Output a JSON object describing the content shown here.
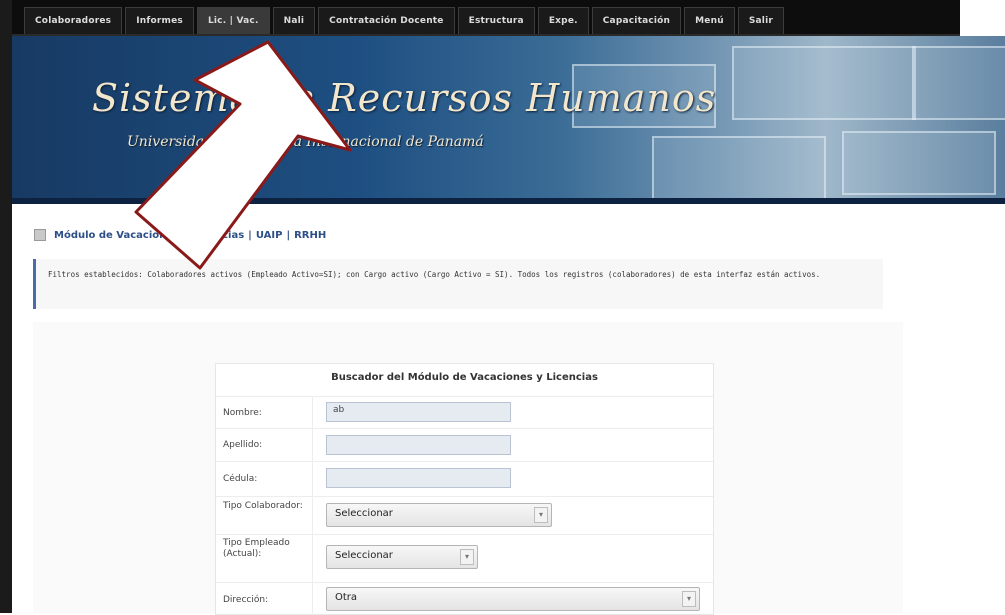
{
  "nav": {
    "tabs": [
      {
        "label": "Colaboradores"
      },
      {
        "label": "Informes"
      },
      {
        "label": "Lic. | Vac."
      },
      {
        "label": "Nali"
      },
      {
        "label": "Contratación Docente"
      },
      {
        "label": "Estructura"
      },
      {
        "label": "Expe."
      },
      {
        "label": "Capacitación"
      },
      {
        "label": "Menú"
      },
      {
        "label": "Salir"
      }
    ]
  },
  "banner": {
    "title": "Sistema de Recursos Humanos",
    "subtitle": "Universidad Tecnológica Internacional de Panamá"
  },
  "breadcrumb": {
    "items": [
      "Módulo de Vacaciones y Licencias",
      "UAIP",
      "RRHH"
    ],
    "separator": "|"
  },
  "note": {
    "text": "Filtros establecidos: Colaboradores activos (Empleado Activo=SI); con Cargo activo (Cargo Activo = SI). Todos los registros (colaboradores) de esta interfaz están activos."
  },
  "form": {
    "title": "Buscador del Módulo de Vacaciones y Licencias",
    "nombre_label": "Nombre:",
    "nombre_value": "ab",
    "apellido_label": "Apellido:",
    "apellido_value": "",
    "cedula_label": "Cédula:",
    "cedula_value": "",
    "tipo_colaborador_label": "Tipo Colaborador:",
    "tipo_colaborador_value": "Seleccionar",
    "tipo_empleado_label": "Tipo Empleado (Actual):",
    "tipo_empleado_value": "Seleccionar",
    "direccion_label": "Dirección:",
    "direccion_value": "Otra"
  },
  "colors": {
    "nav_bg": "#0d0d0d",
    "banner_blue": "#1e4f82",
    "link_blue": "#2c4f87",
    "note_border": "#4a6aa8",
    "arrow_fill": "#ffffff",
    "arrow_stroke": "#8a1a1a"
  }
}
